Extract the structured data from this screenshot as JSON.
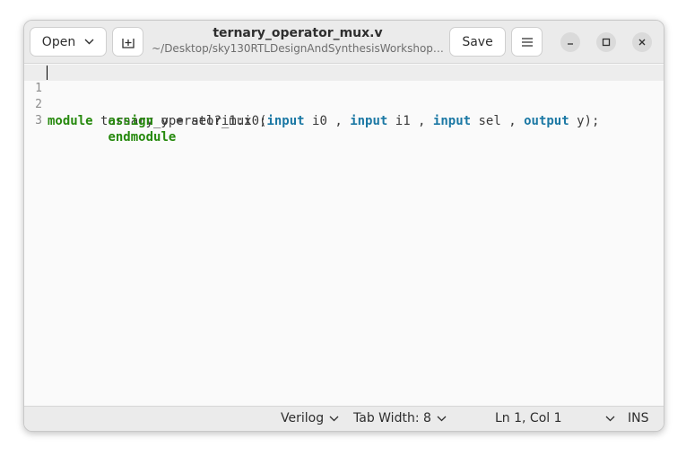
{
  "header": {
    "open_label": "Open",
    "save_label": "Save",
    "title": "ternary_operator_mux.v",
    "subtitle": "~/Desktop/sky130RTLDesignAndSynthesisWorkshop…",
    "icons": [
      "chevron-down-icon",
      "new-tab-icon",
      "hamburger-menu-icon",
      "minimize-icon",
      "maximize-icon",
      "close-icon"
    ]
  },
  "editor": {
    "line_numbers": [
      "1",
      "2",
      "3"
    ],
    "line1": {
      "kw_module": "module",
      "t_name": " ternary_operator_mux (",
      "kw_input1": "input",
      "t_i0": " i0 , ",
      "kw_input2": "input",
      "t_i1": " i1 , ",
      "kw_input3": "input",
      "t_sel": " sel , ",
      "kw_output": "output",
      "t_y": " y);"
    },
    "line2": {
      "indent": "        ",
      "kw_assign": "assign",
      "t_expr": " y = sel?i1:i0;"
    },
    "line3": {
      "indent": "        ",
      "kw_endmodule": "endmodule"
    },
    "colors": {
      "keyword_green": "#26890d",
      "keyword_blue": "#1b78a4",
      "current_line": "#ededed"
    }
  },
  "status": {
    "language": "Verilog",
    "tab_width": "Tab Width: 8",
    "position": "Ln 1, Col 1",
    "mode": "INS"
  }
}
